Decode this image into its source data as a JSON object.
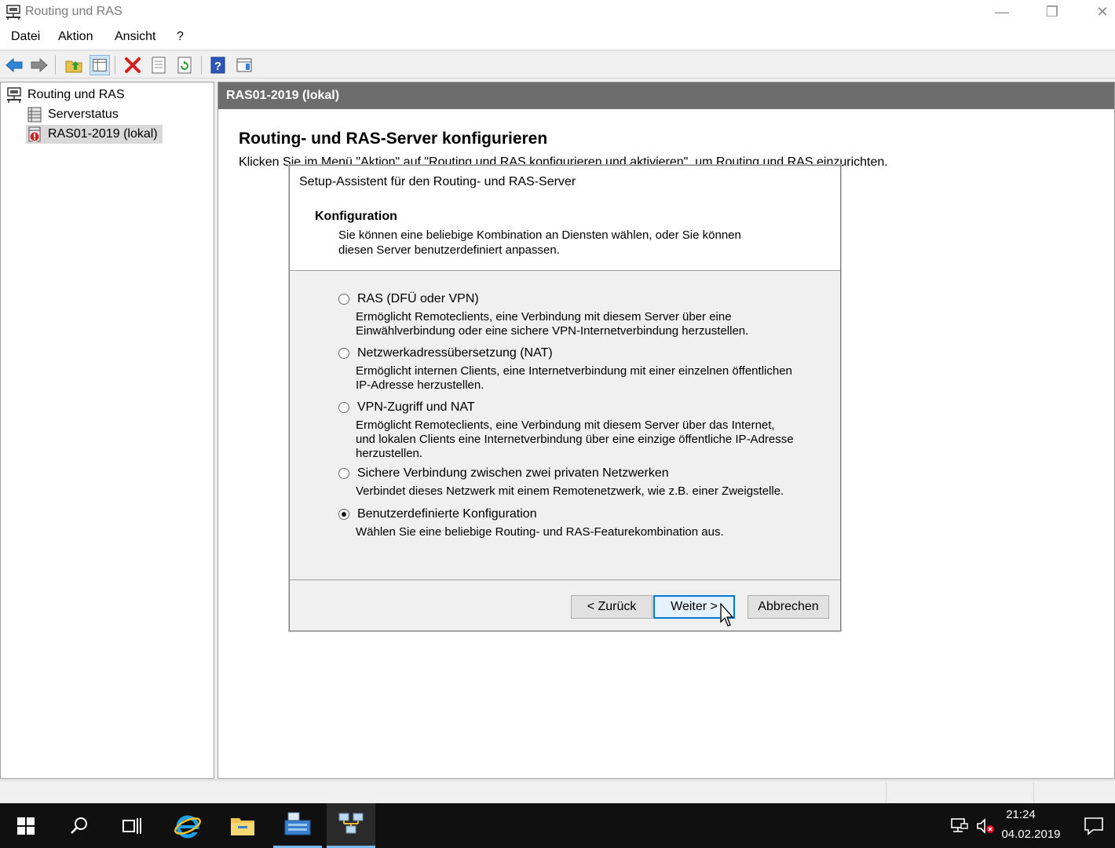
{
  "window": {
    "title": "Routing und RAS",
    "minimize": "—",
    "restore": "❐",
    "close": "✕"
  },
  "menu": {
    "items": [
      "Datei",
      "Aktion",
      "Ansicht",
      "?"
    ]
  },
  "toolbar": {
    "icons": [
      "back-icon",
      "forward-icon",
      "up-folder-icon",
      "show-hide-tree-icon",
      "delete-icon",
      "properties-icon",
      "refresh-icon",
      "help-icon",
      "show-action-pane-icon"
    ]
  },
  "tree": {
    "root": "Routing und RAS",
    "items": [
      "Serverstatus",
      "RAS01-2019 (lokal)"
    ]
  },
  "details": {
    "header": "RAS01-2019 (lokal)",
    "title": "Routing- und RAS-Server konfigurieren",
    "text": "Klicken Sie im Menü \"Aktion\" auf \"Routing und RAS konfigurieren und aktivieren\", um Routing und RAS einzurichten."
  },
  "dialog": {
    "caption": "Setup-Assistent für den Routing- und RAS-Server",
    "section_title": "Konfiguration",
    "section_desc": "Sie können eine beliebige Kombination an Diensten wählen, oder Sie können diesen Server benutzerdefiniert anpassen.",
    "options": [
      {
        "label": "RAS (DFÜ oder VPN)",
        "desc": "Ermöglicht Remoteclients, eine Verbindung mit diesem Server über eine Einwählverbindung oder eine sichere VPN-Internetverbindung herzustellen.",
        "checked": false
      },
      {
        "label": "Netzwerkadressübersetzung (NAT)",
        "desc": "Ermöglicht internen Clients, eine Internetverbindung mit einer einzelnen öffentlichen IP-Adresse herzustellen.",
        "checked": false
      },
      {
        "label": "VPN-Zugriff und NAT",
        "desc": "Ermöglicht Remoteclients, eine Verbindung mit diesem Server über das Internet, und lokalen Clients eine Internetverbindung über eine einzige öffentliche IP-Adresse herzustellen.",
        "checked": false
      },
      {
        "label": "Sichere Verbindung zwischen zwei privaten Netzwerken",
        "desc": "Verbindet dieses Netzwerk mit einem Remotenetzwerk, wie z.B. einer Zweigstelle.",
        "checked": false
      },
      {
        "label": "Benutzerdefinierte Konfiguration",
        "desc": "Wählen Sie eine beliebige Routing- und RAS-Featurekombination aus.",
        "checked": true
      }
    ],
    "buttons": {
      "back": "< Zurück",
      "next": "Weiter >",
      "cancel": "Abbrechen"
    }
  },
  "taskbar": {
    "apps": [
      "start-icon",
      "search-icon",
      "task-view-icon",
      "internet-explorer-icon",
      "file-explorer-icon",
      "server-manager-icon",
      "routing-ras-icon"
    ],
    "time": "21:24",
    "date": "04.02.2019"
  },
  "colors": {
    "header_bar": "#6d6d6d",
    "taskbar": "#101010",
    "accent": "#0078d7"
  }
}
